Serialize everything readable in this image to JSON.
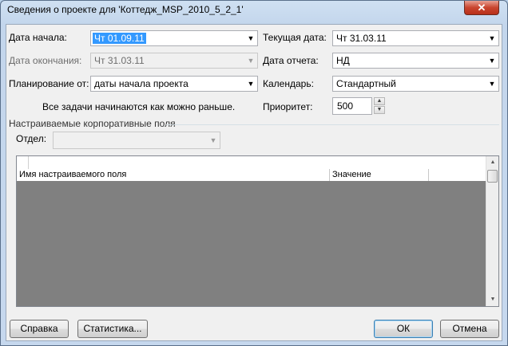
{
  "window": {
    "title": "Сведения о проекте для 'Коттедж_MSP_2010_5_2_1'",
    "close_label": "✕"
  },
  "form": {
    "start_date_label": "Дата начала:",
    "start_date_value": "Чт 01.09.11",
    "finish_date_label": "Дата окончания:",
    "finish_date_value": "Чт 31.03.11",
    "schedule_from_label": "Планирование от:",
    "schedule_from_value": "даты начала проекта",
    "schedule_note": "Все задачи начинаются как можно раньше.",
    "current_date_label": "Текущая дата:",
    "current_date_value": "Чт 31.03.11",
    "status_date_label": "Дата отчета:",
    "status_date_value": "НД",
    "calendar_label": "Календарь:",
    "calendar_value": "Стандартный",
    "priority_label": "Приоритет:",
    "priority_value": "500"
  },
  "custom_fields": {
    "group_title": "Настраиваемые корпоративные поля",
    "department_label": "Отдел:",
    "department_value": "",
    "columns": [
      "Имя настраиваемого поля",
      "Значение"
    ]
  },
  "buttons": {
    "help": "Справка",
    "statistics": "Статистика...",
    "ok": "ОК",
    "cancel": "Отмена"
  }
}
